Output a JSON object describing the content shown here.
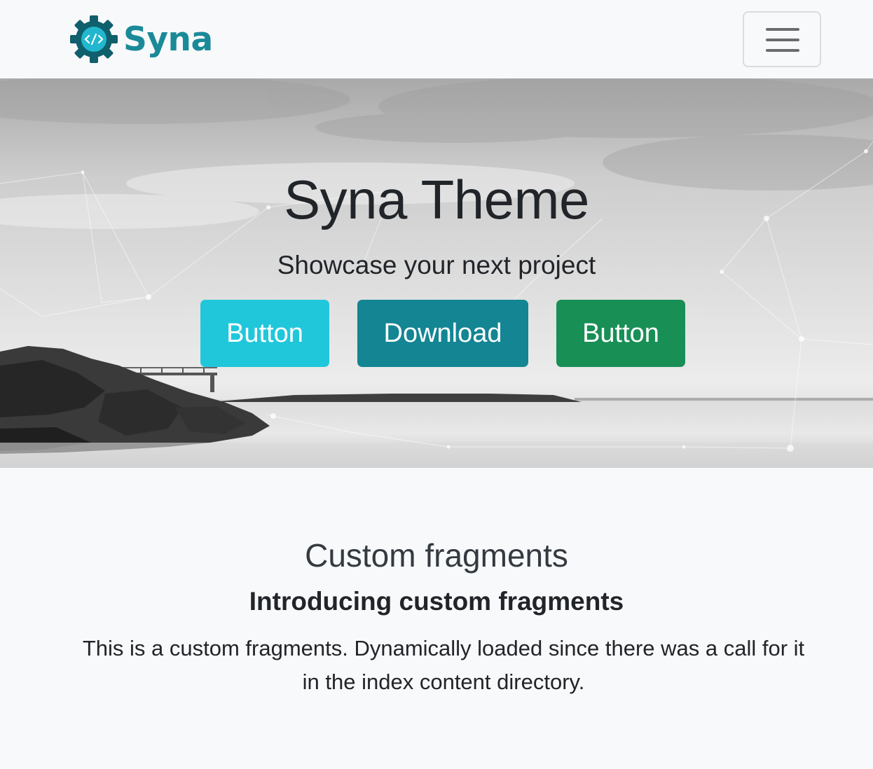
{
  "navbar": {
    "brand_name": "Syna",
    "brand_color": "#1b8a98",
    "logo_icon": "gear-code-icon",
    "toggler_icon": "hamburger-menu-icon"
  },
  "hero": {
    "title": "Syna Theme",
    "subtitle": "Showcase your next project",
    "buttons": [
      {
        "label": "Button",
        "color": "#20c7db"
      },
      {
        "label": "Download",
        "color": "#138593"
      },
      {
        "label": "Button",
        "color": "#188f55"
      }
    ]
  },
  "fragment": {
    "title": "Custom fragments",
    "subtitle": "Introducing custom fragments",
    "text": "This is a custom fragments. Dynamically loaded since there was a call for it in the index content directory."
  }
}
